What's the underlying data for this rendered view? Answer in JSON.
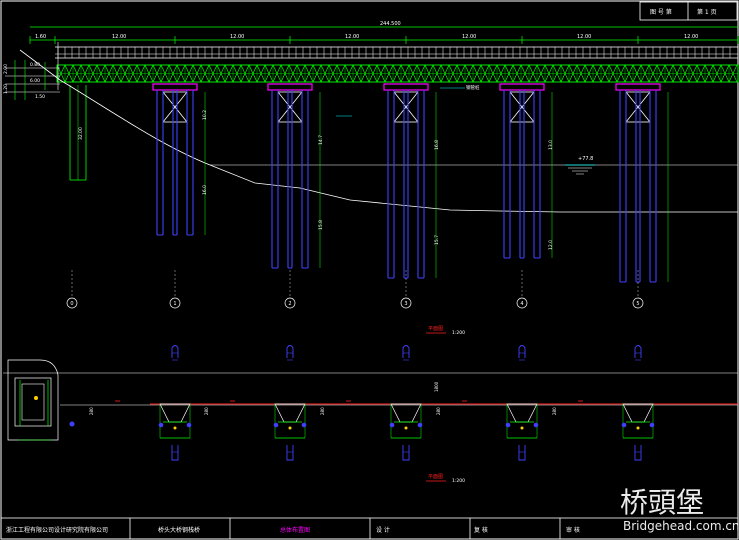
{
  "title_block": {
    "company": "浙江工程有限公司设计研究院有限公司",
    "project": "桥头大桥钢栈桥",
    "drawing": "总体布置图",
    "design_label": "设 计",
    "review_label": "复 核",
    "approve_label": "审 核",
    "sheet_top_left": "图 号 第",
    "sheet_top_right": "第 1 页"
  },
  "watermark": {
    "chinese": "桥頭堡",
    "url": "Bridgehead.com.cn"
  },
  "elevation_view": {
    "total_length_label": "244.500",
    "span_labels": [
      "1.60",
      "12.00",
      "12.00",
      "12.00",
      "12.00",
      "12.00",
      "12.00"
    ],
    "side_labels_left": [
      "2.00",
      "1.20",
      "0.80",
      "6.00",
      "1.50"
    ],
    "pile_length_labels": [
      "32.00",
      "10.2",
      "16.0",
      "14.7",
      "15.8",
      "16.8",
      "15.7",
      "13.0",
      "12.0"
    ],
    "water_level_label": "+77.8",
    "callout_label": "钢管桩"
  },
  "axis_labels": [
    "0",
    "1",
    "2",
    "3",
    "4",
    "5"
  ],
  "plan_view": {
    "section_title_1": "平面图",
    "scale_1": "1:200",
    "section_title_2": "平面图",
    "scale_2": "1:200",
    "dimension_labels": [
      "280",
      "280",
      "280",
      "280",
      "280",
      "1800"
    ]
  },
  "colors": {
    "background": "#000000",
    "structure": "#ffffff",
    "truss": "#00ff00",
    "piles": "#4040ff",
    "cap": "#ff00ff",
    "dimension": "#00ff00",
    "water": "#00ffff",
    "red_line": "#ff2020"
  }
}
